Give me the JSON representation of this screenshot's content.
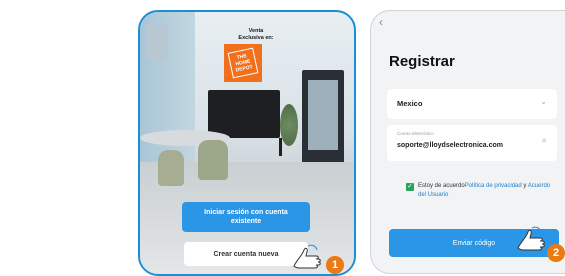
{
  "left_screen": {
    "brand_caption": "Venta\nExclusiva en:",
    "brand_logo_text": "THE HOME DEPOT",
    "login_button": "Iniciar sesión con cuenta existente",
    "create_button": "Crear cuenta nueva",
    "step_badge": "1"
  },
  "right_screen": {
    "back_icon": "‹",
    "title": "Registrar",
    "country_value": "Mexico",
    "email_label": "Correo electrónico",
    "email_value": "soporte@lloydselectronica.com",
    "consent_prefix": "Estoy de acuerdo",
    "privacy_link": "Política de privacidad",
    "consent_and": " y ",
    "terms_link": "Acuerdo del Usuario",
    "send_button": "Enviar código",
    "step_badge": "2"
  },
  "colors": {
    "accent_blue": "#2b95e6",
    "badge_orange": "#ea7a14",
    "brand_orange": "#f26f1b",
    "check_green": "#24a35a"
  }
}
